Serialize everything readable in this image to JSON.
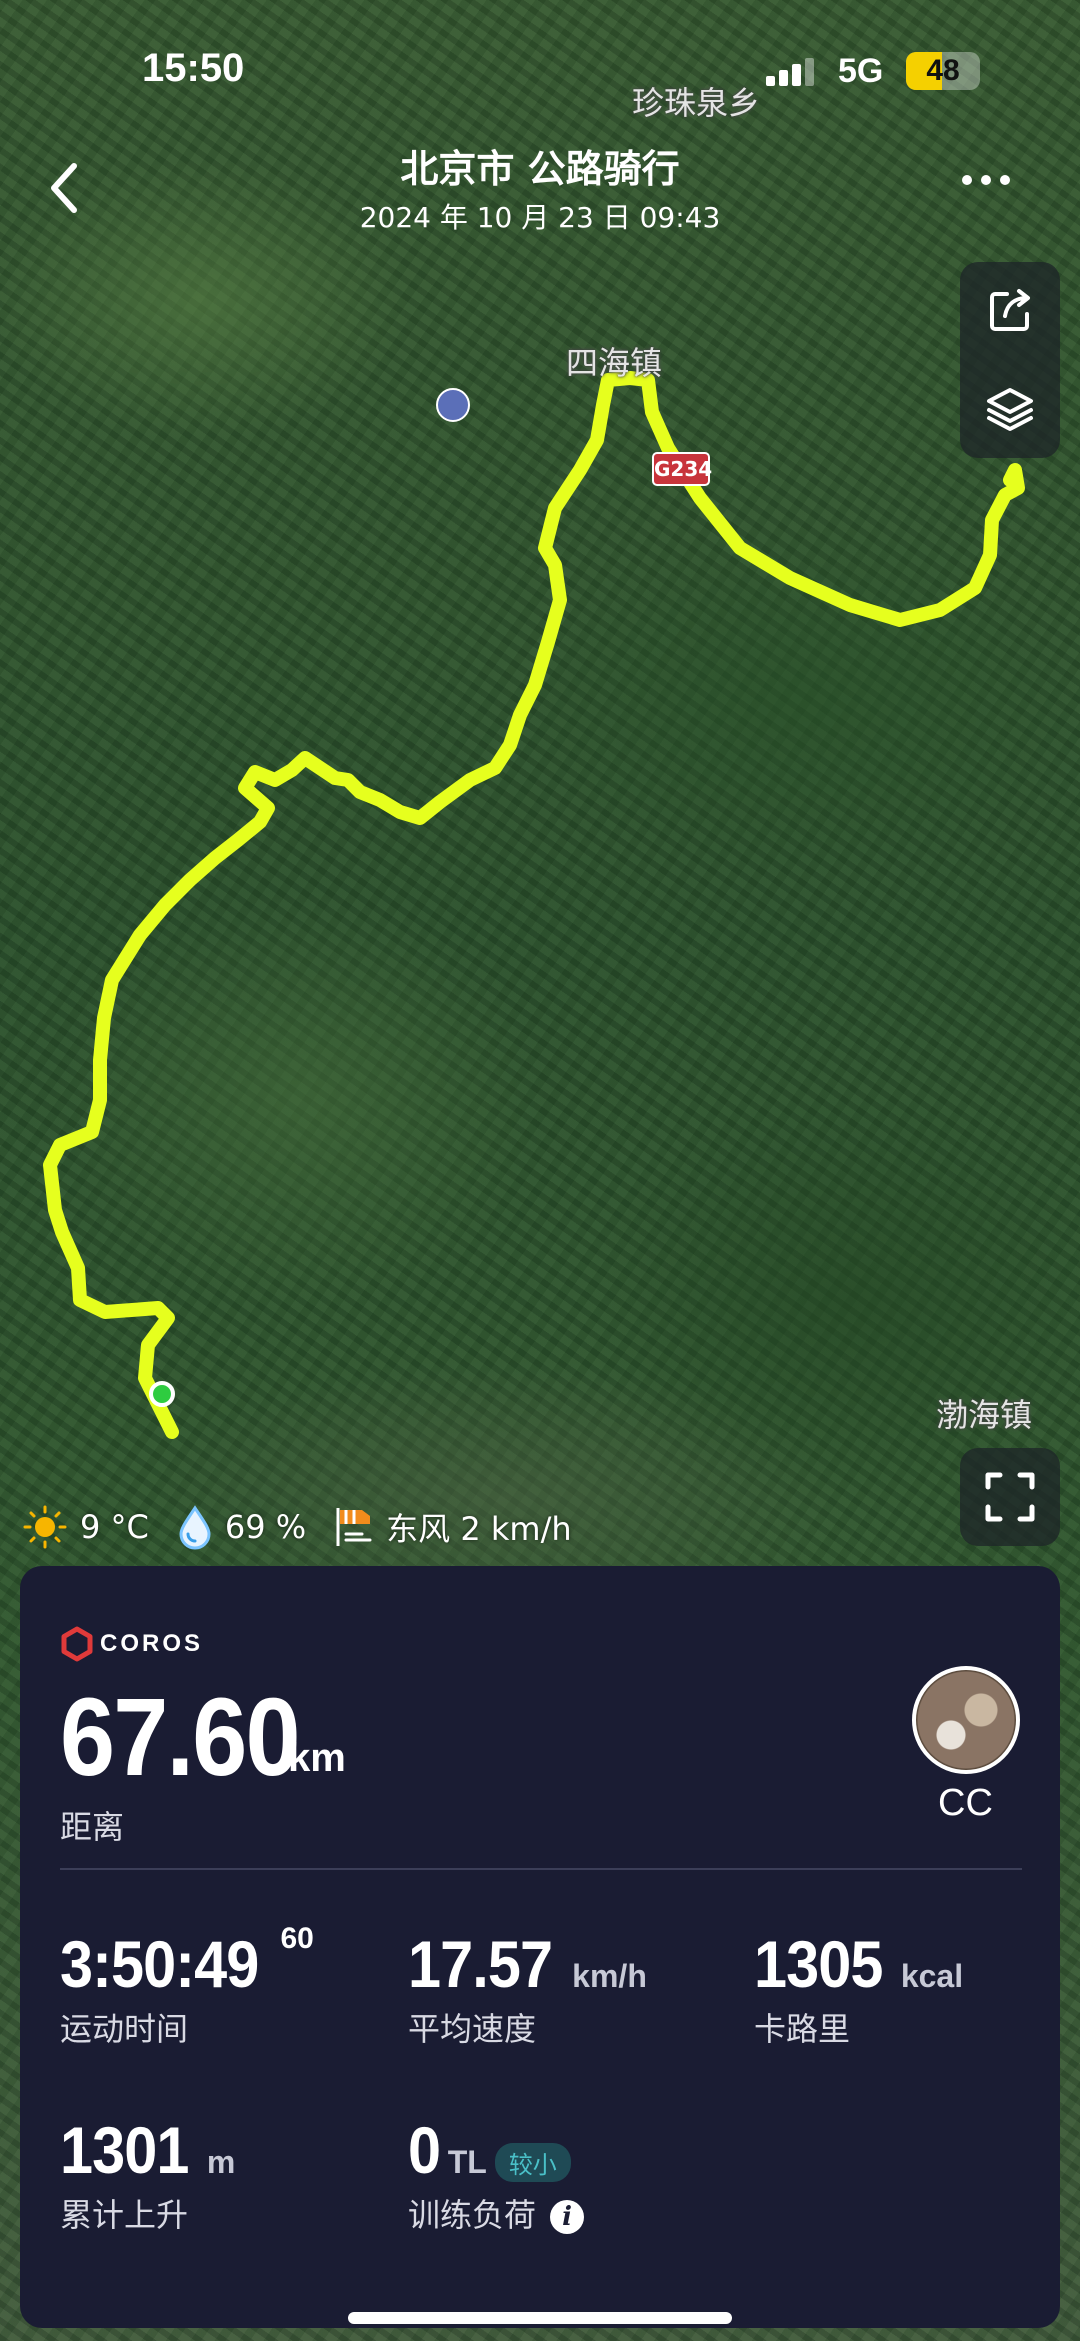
{
  "status_bar": {
    "time": "15:50",
    "network": "5G",
    "battery": "48",
    "battery_level": 0.48
  },
  "header": {
    "title": "北京市 公路骑行",
    "subtitle": "2024 年 10 月 23 日  09:43",
    "back_icon": "chevron-left-icon",
    "more_icon": "more-dots-icon"
  },
  "map": {
    "places": [
      "珍珠泉乡",
      "四海镇",
      "渤海镇"
    ],
    "road_badge": "G234",
    "route_color": "#e6ff1e",
    "start_color": "#2ecc40",
    "tools": [
      "share-icon",
      "layers-icon"
    ],
    "expand_icon": "fullscreen-icon"
  },
  "weather": {
    "temperature": "9 °C",
    "humidity": "69 %",
    "wind": "东风 2 km/h"
  },
  "card": {
    "brand": "COROS",
    "distance": {
      "value": "67.60",
      "unit": "km",
      "label": "距离"
    },
    "user": {
      "name": "CC"
    },
    "stats": [
      {
        "value": "3:50:49",
        "sup": "60",
        "unit": "",
        "label": "运动时间"
      },
      {
        "value": "17.57",
        "unit": "km/h",
        "label": "平均速度"
      },
      {
        "value": "1305",
        "unit": "kcal",
        "label": "卡路里"
      },
      {
        "value": "1301",
        "unit": "m",
        "label": "累计上升"
      },
      {
        "value": "0",
        "unit": "TL",
        "tag": "较小",
        "label": "训练负荷"
      }
    ]
  }
}
